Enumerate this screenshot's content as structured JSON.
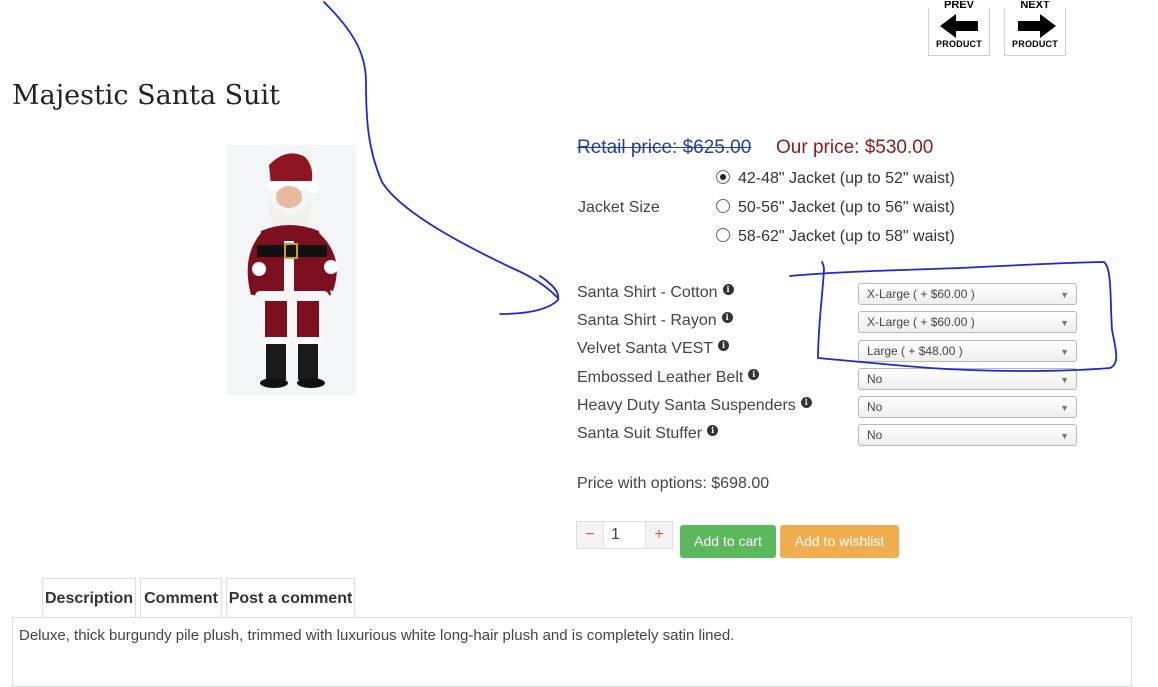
{
  "nav": {
    "prev_top": "PREV",
    "prev_label": "PRODUCT",
    "next_top": "NEXT",
    "next_label": "PRODUCT"
  },
  "product": {
    "title": "Majestic Santa Suit",
    "retail_price": "Retail price: $625.00",
    "our_price": "Our price: $530.00"
  },
  "jacket": {
    "label": "Jacket Size",
    "options": [
      {
        "text": "42-48\" Jacket (up to 52\" waist)",
        "selected": true
      },
      {
        "text": "50-56\" Jacket (up to 56\" waist)",
        "selected": false
      },
      {
        "text": "58-62\" Jacket (up to 58\" waist)",
        "selected": false
      }
    ]
  },
  "options": [
    {
      "label": "Santa Shirt - Cotton",
      "value": "X-Large ( + $60.00 )"
    },
    {
      "label": "Santa Shirt - Rayon",
      "value": "X-Large ( + $60.00 )"
    },
    {
      "label": "Velvet Santa VEST",
      "value": "Large ( + $48.00 )"
    },
    {
      "label": "Embossed Leather Belt",
      "value": "No"
    },
    {
      "label": "Heavy Duty Santa Suspenders",
      "value": "No"
    },
    {
      "label": "Santa Suit Stuffer",
      "value": "No"
    }
  ],
  "price_with_options": "Price with options: $698.00",
  "cart": {
    "minus": "−",
    "quantity": "1",
    "plus": "+",
    "add_to_cart": "Add to cart",
    "add_to_wishlist": "Add to wishlist"
  },
  "tabs": [
    "Description",
    "Comment",
    "Post a comment"
  ],
  "description": "Deluxe, thick burgundy pile plush, trimmed with luxurious white long-hair plush and is completely satin lined.",
  "colors": {
    "retail": "#1f3fa6",
    "our_price": "#8b1a1a",
    "cart_button": "#5cb85c",
    "wishlist_button": "#f0ad4e",
    "annotation_ink": "#1a2ad6"
  },
  "icons": [
    "arrow-left-icon",
    "arrow-right-icon",
    "info-icon",
    "chevron-down-icon"
  ]
}
